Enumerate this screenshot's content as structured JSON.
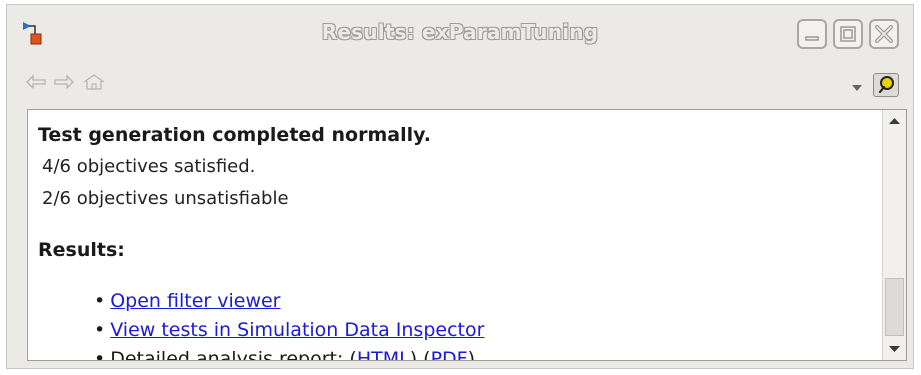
{
  "window": {
    "title": "Results: exParamTuning"
  },
  "content": {
    "heading": "Test generation completed normally.",
    "stats": [
      "4/6 objectives satisfied.",
      "2/6 objectives unsatisfiable"
    ],
    "results_heading": "Results:",
    "results": {
      "bullet": "•",
      "open_filter_viewer": "Open filter viewer",
      "view_tests": "View tests in Simulation Data Inspector",
      "report_prefix": "Detailed analysis report: (",
      "report_html": "HTML",
      "report_sep": ") (",
      "report_pdf": "PDF",
      "report_suffix": ")"
    }
  },
  "colors": {
    "link": "#1a1ad8",
    "window_bg": "#ebeae7"
  },
  "icons": {
    "app": "model-block-icon",
    "back": "back-arrow-icon",
    "forward": "forward-arrow-icon",
    "home": "home-icon",
    "dropdown": "chevron-down-icon",
    "dock": "dock-icon"
  }
}
